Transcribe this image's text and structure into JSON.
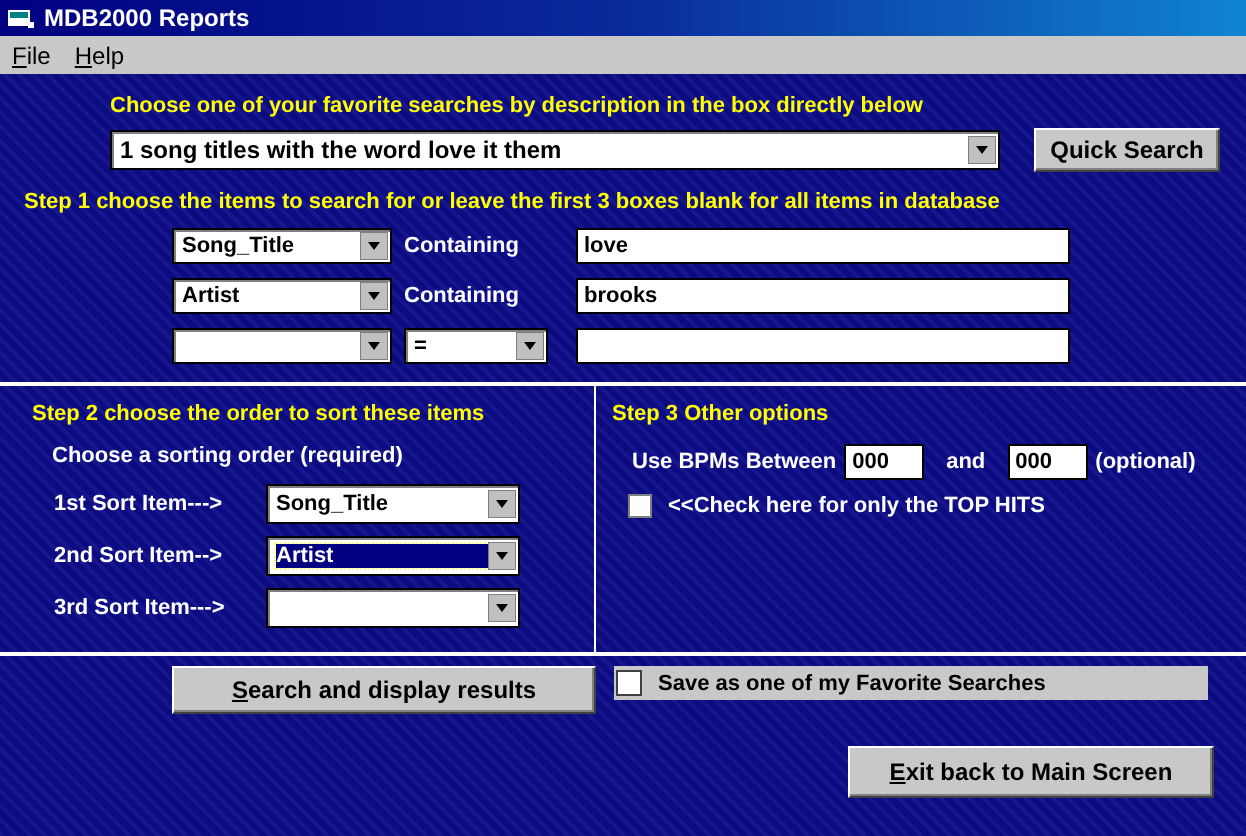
{
  "window": {
    "title": "MDB2000 Reports"
  },
  "menu": [
    {
      "label": "File",
      "underline_first": true
    },
    {
      "label": "Help",
      "underline_first": true
    }
  ],
  "favorites": {
    "heading": "Choose one of your favorite searches by description in the box directly below",
    "selection": "1 song titles with the word love it them",
    "button": {
      "label": "Quick Search"
    }
  },
  "step1": {
    "heading": "Step 1 choose the items to search for or leave the first 3 boxes blank for all items in database",
    "rows": [
      {
        "field": "Song_Title",
        "kind": "label",
        "operator": "Containing",
        "value": "love"
      },
      {
        "field": "Artist",
        "kind": "label",
        "operator": "Containing",
        "value": "brooks"
      },
      {
        "kind": "dropdown",
        "operator": "="
      }
    ]
  },
  "step2": {
    "heading": "Step 2 choose the order to sort these items",
    "prompt": "Choose a sorting order (required)",
    "sorts": [
      {
        "label": "1st Sort Item--->",
        "value": "Song_Title",
        "focused": false
      },
      {
        "label": "2nd Sort Item-->",
        "value": "Artist",
        "focused": true
      },
      {
        "label": "3rd Sort Item--->",
        "focused": false
      }
    ]
  },
  "step3": {
    "heading": "Step 3 Other options",
    "bpm": {
      "label": "Use BPMs Between",
      "from": "000",
      "joiner": "and",
      "to": "000",
      "note": "(optional)"
    },
    "top_hits": {
      "label": "<<Check here for only the TOP HITS",
      "checked": false
    }
  },
  "actions": {
    "search_button": {
      "label": "Search and display results",
      "underline_first": true
    },
    "save_favorite": {
      "label": "Save as one of my Favorite Searches",
      "checked": false
    },
    "exit_button": {
      "label": "Exit back to Main Screen",
      "underline_first": true
    }
  }
}
